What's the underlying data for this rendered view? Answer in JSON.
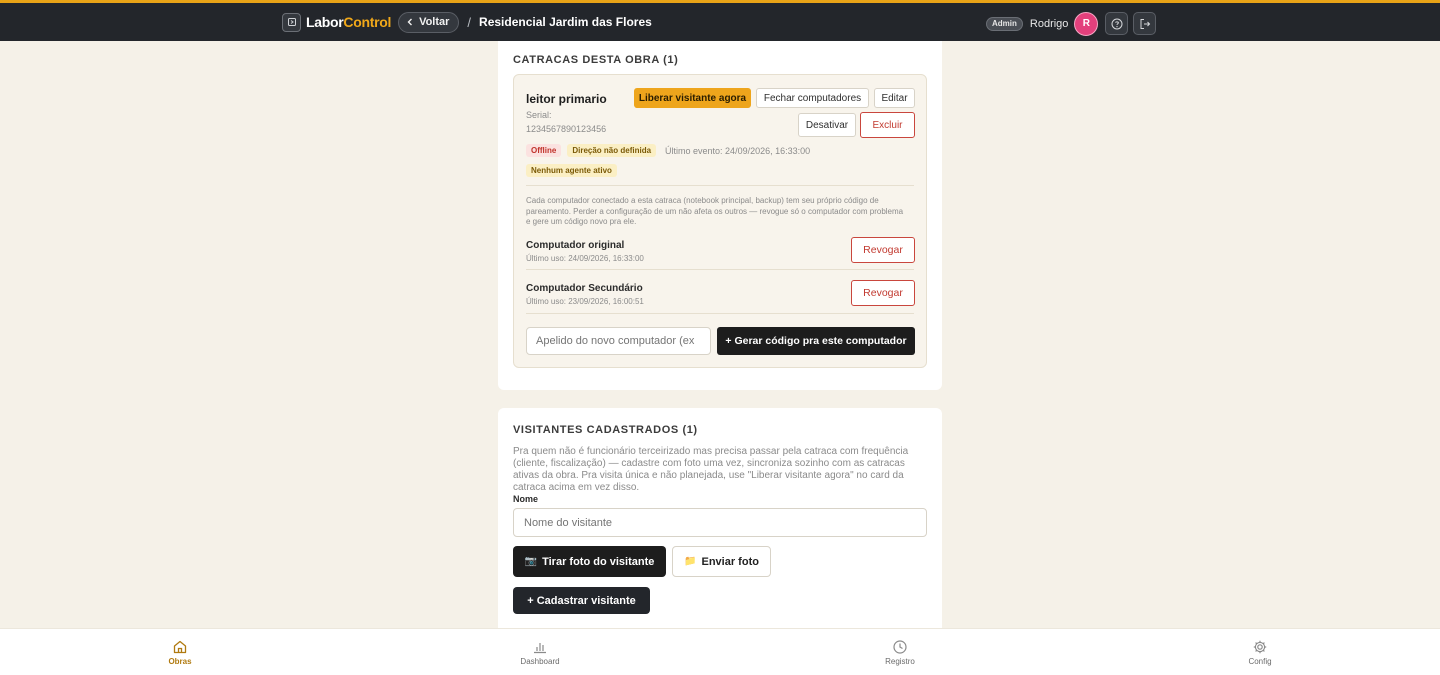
{
  "topbar": {
    "brand_a": "Labor",
    "brand_b": "Control",
    "back_label": "Voltar",
    "separator": "/",
    "breadcrumb": "Residencial Jardim das Flores",
    "role": "Admin",
    "user": "Rodrigo",
    "avatar_initial": "R"
  },
  "turnstiles": {
    "title": "CATRACAS DESTA OBRA (1)",
    "item": {
      "name": "leitor primario",
      "serial_label": "Serial:",
      "serial_value": "1234567890123456",
      "release_button": "Liberar visitante agora",
      "close_button": "Fechar computadores",
      "edit_button": "Editar",
      "deactivate_button": "Desativar",
      "delete_button": "Excluir",
      "status_badge": "Offline",
      "direction_badge": "Direção não definida",
      "last_event": "Último evento: 24/09/2026, 16:33:00",
      "agent_badge": "Nenhum agente ativo",
      "info": "Cada computador conectado a esta catraca (notebook principal, backup) tem seu próprio código de pareamento. Perder a configuração de um não afeta os outros — revogue só o computador com problema e gere um código novo pra ele.",
      "computers": [
        {
          "name": "Computador original",
          "last_use": "Último uso: 24/09/2026, 16:33:00",
          "revoke_label": "Revogar"
        },
        {
          "name": "Computador Secundário",
          "last_use": "Último uso: 23/09/2026, 16:00:51",
          "revoke_label": "Revogar"
        }
      ],
      "nickname_placeholder": "Apelido do novo computador (ex",
      "generate_button": "+ Gerar código pra este computador"
    }
  },
  "visitors": {
    "title": "VISITANTES CADASTRADOS (1)",
    "description": "Pra quem não é funcionário terceirizado mas precisa passar pela catraca com frequência (cliente, fiscalização) — cadastre com foto uma vez, sincroniza sozinho com as catracas ativas da obra. Pra visita única e não planejada, use \"Liberar visitante agora\" no card da catraca acima em vez disso.",
    "name_label": "Nome",
    "name_placeholder": "Nome do visitante",
    "take_photo_icon": "📷",
    "take_photo_button": "Tirar foto do visitante",
    "send_photo_icon": "📁",
    "send_photo_button": "Enviar foto",
    "register_button": "+ Cadastrar visitante"
  },
  "bottom_nav": {
    "items": [
      {
        "label": "Obras",
        "icon": "home-icon",
        "active": true
      },
      {
        "label": "Dashboard",
        "icon": "bar-chart-icon",
        "active": false
      },
      {
        "label": "Registro",
        "icon": "clock-icon",
        "active": false
      },
      {
        "label": "Config",
        "icon": "gear-icon",
        "active": false
      }
    ]
  },
  "colors": {
    "accent": "#eea51c",
    "topbar_bg": "#23262b",
    "page_bg": "#f5f1e8",
    "danger": "#c23a30",
    "avatar": "#e3407c"
  }
}
